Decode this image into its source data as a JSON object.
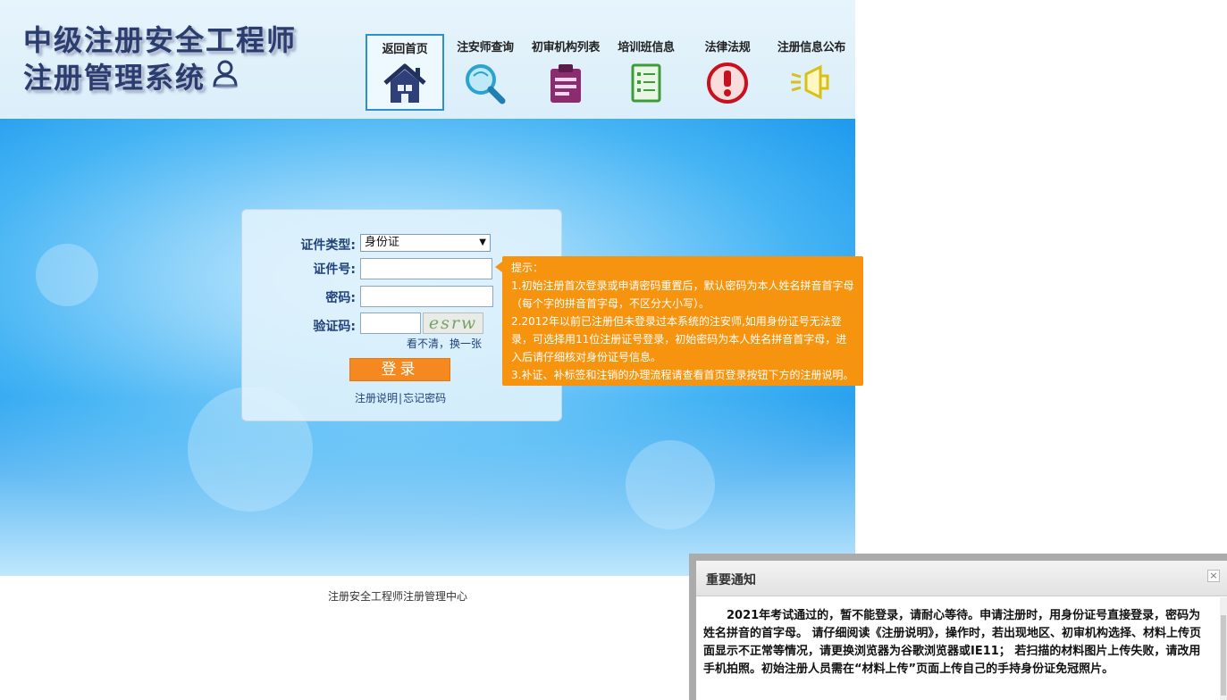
{
  "header": {
    "title_line1": "中级注册安全工程师",
    "title_line2": "注册管理系统",
    "nav": [
      {
        "label": "返回首页",
        "icon": "home-icon",
        "active": true
      },
      {
        "label": "注安师查询",
        "icon": "magnifier-icon",
        "active": false
      },
      {
        "label": "初审机构列表",
        "icon": "clipboard-icon",
        "active": false
      },
      {
        "label": "培训班信息",
        "icon": "document-list-icon",
        "active": false
      },
      {
        "label": "法律法规",
        "icon": "exclamation-icon",
        "active": false
      },
      {
        "label": "注册信息公布",
        "icon": "megaphone-icon",
        "active": false
      }
    ]
  },
  "login": {
    "id_type_label": "证件类型:",
    "id_type_value": "身份证",
    "id_number_label": "证件号:",
    "password_label": "密码:",
    "captcha_label": "验证码:",
    "captcha_text": "esrw",
    "refresh_text": "看不清，换一张",
    "login_button": "登录",
    "register_help_link": "注册说明",
    "separator": "|",
    "forgot_password_link": "忘记密码"
  },
  "tip": {
    "title": "提示：",
    "lines": [
      "1.初始注册首次登录或申请密码重置后，默认密码为本人姓名拼音首字母（每个字的拼音首字母，不区分大小写）。",
      "2.2012年以前已注册但未登录过本系统的注安师,如用身份证号无法登录，可选择用11位注册证号登录，初始密码为本人姓名拼音首字母，进入后请仔细核对身份证号信息。",
      "3.补证、补标签和注销的办理流程请查看首页登录按钮下方的注册说明。"
    ]
  },
  "footer": {
    "text": "注册安全工程师注册管理中心"
  },
  "notice": {
    "title": "重要通知",
    "close_symbol": "×",
    "body": "2021年考试通过的，暂不能登录，请耐心等待。申请注册时，用身份证号直接登录，密码为姓名拼音的首字母。 请仔细阅读《注册说明》，操作时，若出现地区、初审机构选择、材料上传页面显示不正常等情况，请更换浏览器为谷歌浏览器或IE11； 若扫描的材料图片上传失败，请改用手机拍照。初始注册人员需在“材料上传”页面上传自己的手持身份证免冠照片。"
  },
  "colors": {
    "brand_text": "#2a3d6e",
    "accent_orange": "#f7940f",
    "login_button": "#f5881f",
    "link_blue": "#20427a",
    "active_nav_border": "#2a8fd3"
  }
}
